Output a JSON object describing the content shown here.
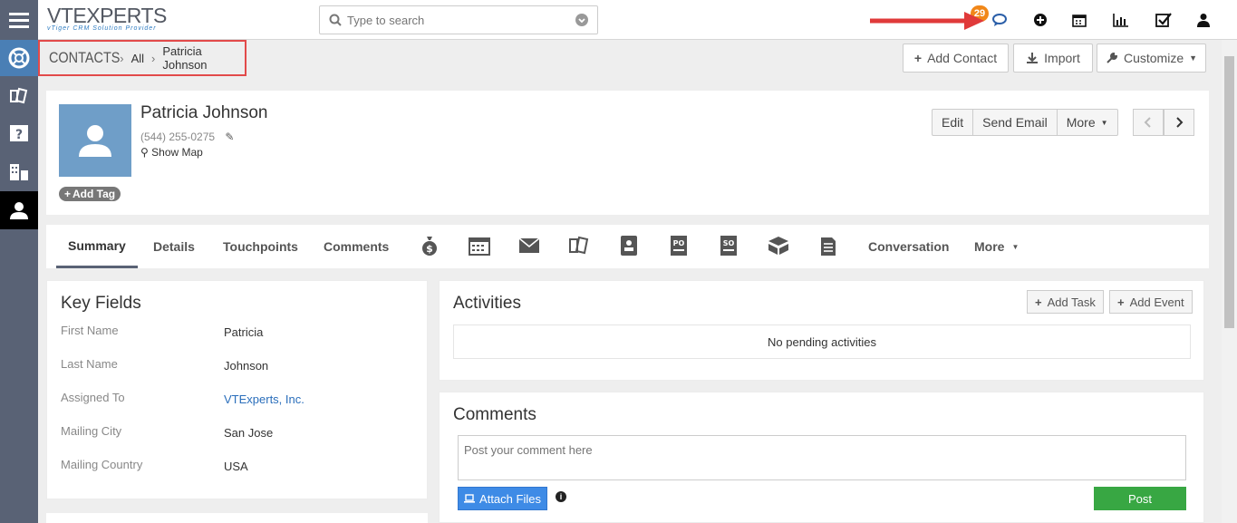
{
  "header": {
    "logo_main": "VTEXPERTS",
    "logo_sub": "vTiger CRM Solution Provider",
    "search_placeholder": "Type to search",
    "notification_count": "29",
    "icons": [
      "comments-icon",
      "plus-circle-icon",
      "calendar-icon",
      "bar-chart-icon",
      "check-square-icon",
      "user-icon"
    ]
  },
  "rail": {
    "icons": [
      "menu-icon",
      "support-icon",
      "tickets-icon",
      "faq-icon",
      "organizations-icon",
      "contacts-icon"
    ]
  },
  "breadcrumb": {
    "module": "CONTACTS",
    "filter": "All",
    "record": "Patricia Johnson"
  },
  "toolbar": {
    "add_contact": "Add Contact",
    "import": "Import",
    "customize": "Customize"
  },
  "record": {
    "name": "Patricia Johnson",
    "phone": "(544) 255-0275",
    "show_map": "Show Map",
    "add_tag": "Add Tag",
    "actions": {
      "edit": "Edit",
      "send_email": "Send Email",
      "more": "More"
    }
  },
  "tabs": {
    "summary": "Summary",
    "details": "Details",
    "touchpoints": "Touchpoints",
    "comments": "Comments",
    "conversation": "Conversation",
    "more": "More",
    "icons": [
      "money-bag-icon",
      "calendar-grid-icon",
      "envelope-icon",
      "tickets-icon",
      "contact-book-icon",
      "purchase-order-icon",
      "sales-order-icon",
      "package-icon",
      "document-icon"
    ]
  },
  "key_fields": {
    "title": "Key Fields",
    "rows": [
      {
        "label": "First Name",
        "value": "Patricia"
      },
      {
        "label": "Last Name",
        "value": "Johnson"
      },
      {
        "label": "Assigned To",
        "value": "VTExperts, Inc."
      },
      {
        "label": "Mailing City",
        "value": "San Jose"
      },
      {
        "label": "Mailing Country",
        "value": "USA"
      }
    ]
  },
  "activities": {
    "title": "Activities",
    "add_task": "Add Task",
    "add_event": "Add Event",
    "empty": "No pending activities"
  },
  "comments": {
    "title": "Comments",
    "placeholder": "Post your comment here",
    "attach": "Attach Files",
    "post": "Post"
  },
  "colors": {
    "rail": "#596275",
    "accent_blue": "#4a7fb5",
    "badge": "#f18718",
    "post_green": "#38a743",
    "highlight_red": "#e24a4a"
  }
}
